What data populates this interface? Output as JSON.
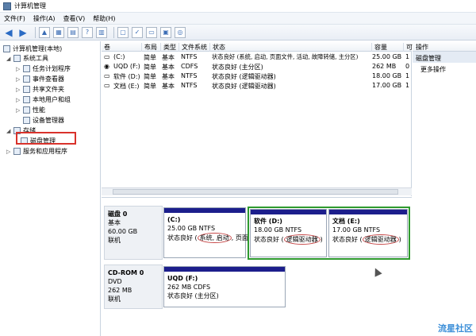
{
  "window": {
    "title": "计算机管理"
  },
  "menu": [
    "文件(F)",
    "操作(A)",
    "查看(V)",
    "帮助(H)"
  ],
  "tree": {
    "root": "计算机管理(本地)",
    "system_tools": "系统工具",
    "task_scheduler": "任务计划程序",
    "event_viewer": "事件查看器",
    "shared_folders": "共享文件夹",
    "local_users": "本地用户和组",
    "performance": "性能",
    "device_manager": "设备管理器",
    "storage": "存储",
    "disk_management": "磁盘管理",
    "services": "服务和应用程序"
  },
  "table": {
    "headers": [
      "卷",
      "布局",
      "类型",
      "文件系统",
      "状态",
      "容量",
      "可"
    ],
    "rows": [
      [
        "(C:)",
        "简单",
        "基本",
        "NTFS",
        "状态良好 (系统, 启动, 页面文件, 活动, 故障转储, 主分区)",
        "25.00 GB",
        "1"
      ],
      [
        "UQD (F:)",
        "简单",
        "基本",
        "CDFS",
        "状态良好 (主分区)",
        "262 MB",
        "0"
      ],
      [
        "软件 (D:)",
        "简单",
        "基本",
        "NTFS",
        "状态良好 (逻辑驱动器)",
        "18.00 GB",
        "1"
      ],
      [
        "文档 (E:)",
        "简单",
        "基本",
        "NTFS",
        "状态良好 (逻辑驱动器)",
        "17.00 GB",
        "1"
      ]
    ]
  },
  "actions": {
    "header": "操作",
    "selected": "磁盘管理",
    "more": "更多操作"
  },
  "disk0": {
    "name": "磁盘 0",
    "type": "基本",
    "size": "60.00 GB",
    "status": "联机",
    "partitions": [
      {
        "name": "(C:)",
        "size": "25.00 GB NTFS",
        "status_prefix": "状态良好 (",
        "status_circled": "系统, 启动",
        "status_suffix": ", 页面"
      },
      {
        "name": "软件 (D:)",
        "size": "18.00 GB NTFS",
        "status_prefix": "状态良好 (",
        "status_circled": "逻辑驱动器",
        "status_suffix": ")"
      },
      {
        "name": "文档 (E:)",
        "size": "17.00 GB NTFS",
        "status_prefix": "状态良好 (",
        "status_circled": "逻辑驱动器",
        "status_suffix": ")"
      }
    ]
  },
  "cdrom": {
    "name": "CD-ROM 0",
    "type": "DVD",
    "size": "262 MB",
    "status": "联机",
    "partition": {
      "name": "UQD (F:)",
      "size": "262 MB CDFS",
      "status": "状态良好 (主分区)"
    }
  },
  "watermark": "流星社区",
  "colors": {
    "partition_bar": "#1c1e8c",
    "highlight_red": "#d9322b",
    "group_green": "#2e9a2e"
  }
}
